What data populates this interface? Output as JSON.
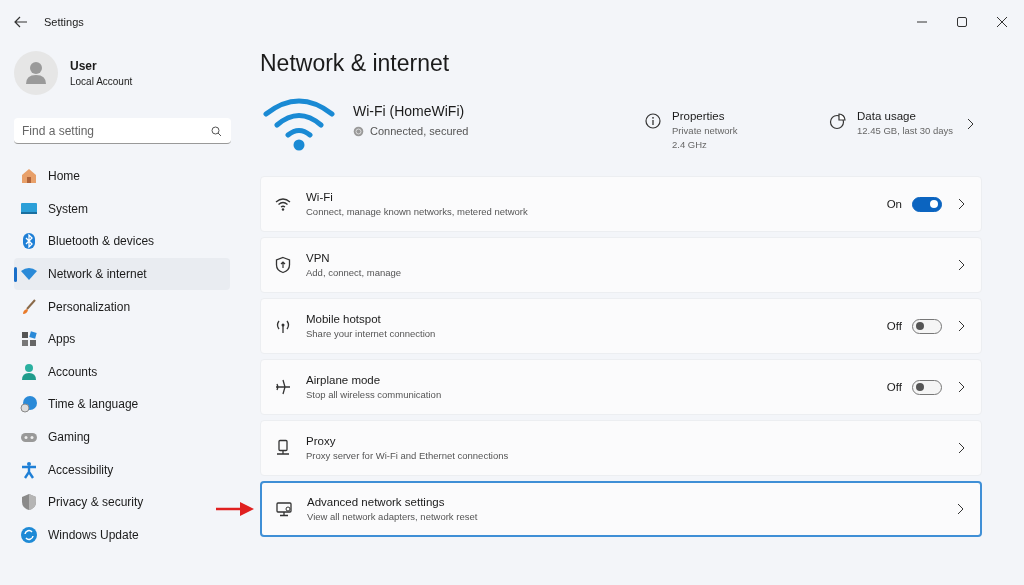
{
  "window": {
    "title": "Settings"
  },
  "user": {
    "name": "User",
    "account": "Local Account"
  },
  "search": {
    "placeholder": "Find a setting"
  },
  "nav": [
    {
      "label": "Home",
      "selected": false
    },
    {
      "label": "System",
      "selected": false
    },
    {
      "label": "Bluetooth & devices",
      "selected": false
    },
    {
      "label": "Network & internet",
      "selected": true
    },
    {
      "label": "Personalization",
      "selected": false
    },
    {
      "label": "Apps",
      "selected": false
    },
    {
      "label": "Accounts",
      "selected": false
    },
    {
      "label": "Time & language",
      "selected": false
    },
    {
      "label": "Gaming",
      "selected": false
    },
    {
      "label": "Accessibility",
      "selected": false
    },
    {
      "label": "Privacy & security",
      "selected": false
    },
    {
      "label": "Windows Update",
      "selected": false
    }
  ],
  "page_title": "Network & internet",
  "connection": {
    "name": "Wi-Fi (HomeWiFi)",
    "status": "Connected, secured"
  },
  "properties": {
    "title": "Properties",
    "lines": [
      "Private network",
      "2.4 GHz"
    ]
  },
  "data_usage": {
    "title": "Data usage",
    "detail": "12.45 GB, last 30 days"
  },
  "rows": [
    {
      "kind": "toggle",
      "title": "Wi-Fi",
      "subtitle": "Connect, manage known networks, metered network",
      "state": "On",
      "on": true,
      "selected": false
    },
    {
      "kind": "link",
      "title": "VPN",
      "subtitle": "Add, connect, manage",
      "selected": false
    },
    {
      "kind": "toggle",
      "title": "Mobile hotspot",
      "subtitle": "Share your internet connection",
      "state": "Off",
      "on": false,
      "selected": false
    },
    {
      "kind": "toggle",
      "title": "Airplane mode",
      "subtitle": "Stop all wireless communication",
      "state": "Off",
      "on": false,
      "selected": false
    },
    {
      "kind": "link",
      "title": "Proxy",
      "subtitle": "Proxy server for Wi-Fi and Ethernet connections",
      "selected": false
    },
    {
      "kind": "link",
      "title": "Advanced network settings",
      "subtitle": "View all network adapters, network reset",
      "selected": true
    }
  ]
}
